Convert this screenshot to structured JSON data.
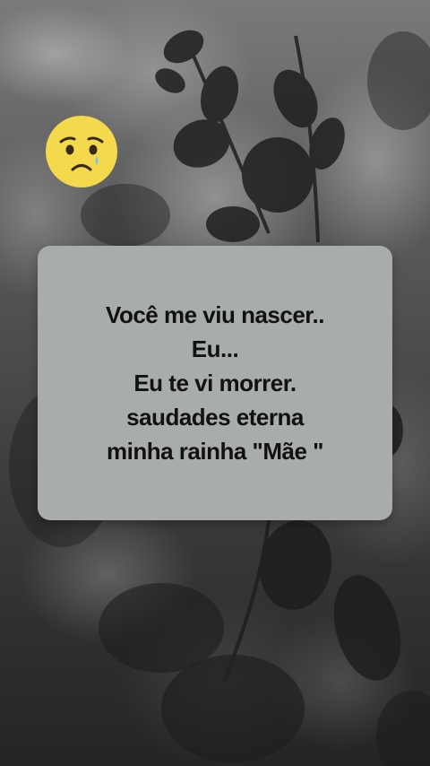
{
  "scene": {
    "emoji_icon": "crying-sad-face-icon",
    "emoji_color": "#f3d94b"
  },
  "quote": {
    "lines": [
      "Você me viu nascer..",
      "Eu...",
      "Eu te vi morrer.",
      "saudades eterna",
      "minha rainha \"Mãe \""
    ],
    "card_color": "#a9adaa"
  }
}
